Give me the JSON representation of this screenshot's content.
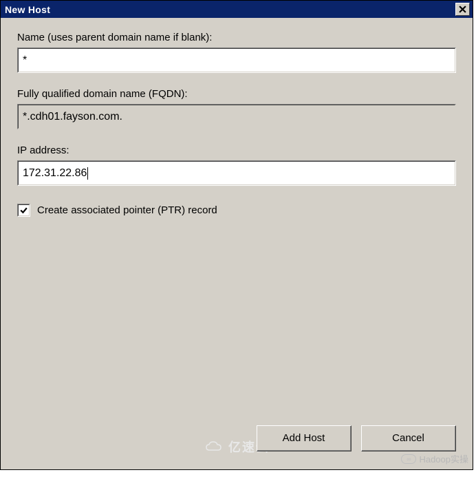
{
  "window": {
    "title": "New Host"
  },
  "fields": {
    "name": {
      "label": "Name (uses parent domain name if blank):",
      "value": "*"
    },
    "fqdn": {
      "label": "Fully qualified domain name (FQDN):",
      "value": "*.cdh01.fayson.com."
    },
    "ip": {
      "label": "IP address:",
      "value": "172.31.22.86"
    }
  },
  "checkbox": {
    "ptr": {
      "label": "Create associated pointer (PTR) record",
      "checked": true
    }
  },
  "buttons": {
    "add_host": "Add Host",
    "cancel": "Cancel"
  },
  "watermark": {
    "text": "Hadoop实操",
    "yisu": "亿速云"
  }
}
